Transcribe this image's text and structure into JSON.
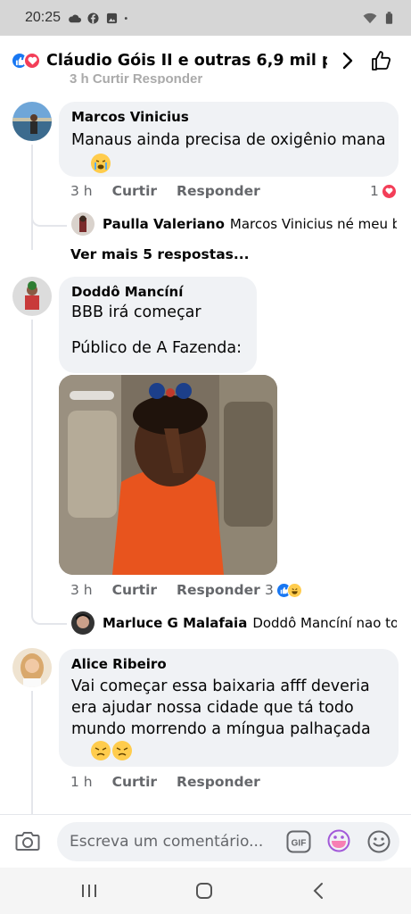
{
  "status_bar": {
    "time": "20:25"
  },
  "header": {
    "title": "Cláudio Góis II e outras 6,9 mil pes..."
  },
  "partial_row": "3 h    Curtir    Responder",
  "comments": [
    {
      "author": "Marcos Vinicius",
      "text": "Manaus ainda precisa de oxigênio mana",
      "time": "3 h",
      "like": "Curtir",
      "reply": "Responder",
      "reaction_count": "1",
      "replies": [
        {
          "author": "Paulla Valeriano",
          "text": "Marcos Vinicius né meu b..."
        }
      ],
      "more_replies": "Ver mais 5 respostas..."
    },
    {
      "author": "Doddô Mancíní",
      "text": "BBB irá começar\n\nPúblico de A Fazenda:",
      "time": "3 h",
      "like": "Curtir",
      "reply": "Responder",
      "reaction_count": "3",
      "replies": [
        {
          "author": "Marluce G Malafaia",
          "text": "Doddô Mancíní nao to..."
        }
      ]
    },
    {
      "author": "Alice Ribeiro",
      "text": "Vai começar essa baixaria afff deveria era ajudar nossa cidade que tá todo mundo morrendo a míngua palhaçada",
      "time": "1 h",
      "like": "Curtir",
      "reply": "Responder"
    }
  ],
  "composer": {
    "placeholder": "Escreva um comentário..."
  },
  "colors": {
    "like_blue": "#1877f2",
    "love_red": "#f33e58",
    "bubble": "#f0f2f5",
    "meta_gray": "#65676b"
  },
  "icons": [
    "camera-icon",
    "gif-icon",
    "sticker-icon",
    "emoji-icon",
    "like-outline-icon",
    "chevron-right-icon"
  ]
}
